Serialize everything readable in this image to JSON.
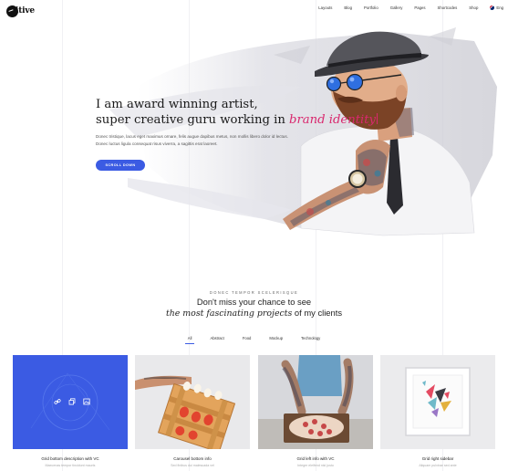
{
  "brand": {
    "logo_text": "itive"
  },
  "nav": {
    "items": [
      "Layouts",
      "Blog",
      "Portfolio",
      "Gallery",
      "Pages",
      "Shortcodes",
      "Shop"
    ],
    "language": "Eng"
  },
  "hero": {
    "line1": "I am award winning artist,",
    "line2_prefix": "super creative guru working in ",
    "line2_accent": "brand identity",
    "lead": "Donec tristique, lacus eget maximus ornare, felis augue dapibus metus, non mollis libero dolor id lectus. Donec luctus ligula consequat risus viverra, a sagittis erat laoreet.",
    "button_label": "SCROLL DOWN"
  },
  "section": {
    "eyebrow": "DONEC TEMPOR SCELERISQUE",
    "title_line1": "Don't miss your chance to see",
    "title_line2_italic": "the most fascinating projects",
    "title_line2_rest": " of my clients"
  },
  "filters": {
    "items": [
      "All",
      "Abstract",
      "Food",
      "Mockup",
      "Technology"
    ],
    "active": "All"
  },
  "portfolio": [
    {
      "title": "Grid bottom description with VC",
      "subtitle": "Maecenas tempor tincidunt mauris"
    },
    {
      "title": "Carousel bottom info",
      "subtitle": "Sed finibus dui malesuada vel"
    },
    {
      "title": "Grid left info with VC",
      "subtitle": "Integer eleifend nisl justo"
    },
    {
      "title": "Grid right sidebar",
      "subtitle": "Aliquam pulvinar sed ante"
    }
  ],
  "colors": {
    "accent_pink": "#d9286e",
    "accent_blue": "#3b5be3",
    "card1_bg": "#3b5be3"
  },
  "icons": [
    "link-icon",
    "copy-icon",
    "image-icon"
  ]
}
